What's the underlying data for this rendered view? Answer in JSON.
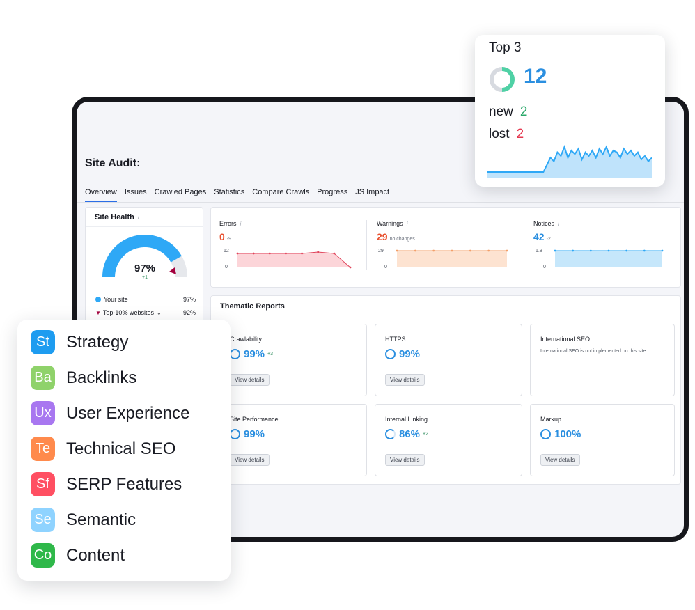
{
  "site_audit": {
    "title": "Site Audit:",
    "tabs": [
      "Overview",
      "Issues",
      "Crawled Pages",
      "Statistics",
      "Compare Crawls",
      "Progress",
      "JS Impact"
    ]
  },
  "site_health": {
    "title": "Site Health",
    "info": "i",
    "value": "97%",
    "delta": "+1",
    "gauge_fraction": 0.97,
    "legend": [
      {
        "label": "Your site",
        "value": "97%"
      },
      {
        "label": "Top-10% websites",
        "value": "92%"
      }
    ]
  },
  "summary": {
    "errors": {
      "label": "Errors",
      "info": "i",
      "value": "0",
      "delta": "-9",
      "color": "#e8502f",
      "ymax": "12",
      "ymin": "0",
      "values": [
        10,
        10,
        10,
        10,
        10,
        11,
        10,
        0
      ]
    },
    "warnings": {
      "label": "Warnings",
      "info": "i",
      "value": "29",
      "delta": "no changes",
      "color": "#e8502f",
      "ymax": "29",
      "ymin": "0",
      "values": [
        29,
        29,
        29,
        29,
        29,
        29,
        29
      ]
    },
    "notices": {
      "label": "Notices",
      "info": "i",
      "value": "42",
      "delta": "-2",
      "color": "#2b8fe0",
      "ymax": "1.8",
      "ymin": "0",
      "values": [
        1.8,
        1.8,
        1.8,
        1.8,
        1.8,
        1.8,
        1.8
      ]
    }
  },
  "thematic": {
    "title": "Thematic Reports",
    "view_label": "View details",
    "reports": [
      {
        "name": "Crawlability",
        "value": "99%",
        "delta": "+3"
      },
      {
        "name": "HTTPS",
        "value": "99%",
        "delta": ""
      },
      {
        "name": "International SEO",
        "note": "International SEO is not implemented on this site."
      },
      {
        "name": "Site Performance",
        "value": "99%",
        "delta": ""
      },
      {
        "name": "Internal Linking",
        "value": "86%",
        "delta": "+2"
      },
      {
        "name": "Markup",
        "value": "100%",
        "delta": ""
      }
    ]
  },
  "top3": {
    "title": "Top 3",
    "value": "12",
    "new_label": "new",
    "new_value": "2",
    "lost_label": "lost",
    "lost_value": "2",
    "trend": [
      0,
      0,
      0,
      0,
      0,
      0,
      0,
      0,
      0,
      0,
      0,
      0,
      0,
      0,
      0,
      0,
      0,
      4,
      8,
      6,
      11,
      9,
      14,
      8,
      12,
      10,
      13,
      7,
      11,
      9,
      12,
      8,
      13,
      10,
      14,
      9,
      12,
      11,
      8,
      13,
      10,
      12,
      9,
      11,
      7,
      9,
      6,
      8
    ]
  },
  "tools": [
    {
      "abbr": "St",
      "label": "Strategy",
      "color": "#1e9cf0"
    },
    {
      "abbr": "Ba",
      "label": "Backlinks",
      "color": "#8fd26a"
    },
    {
      "abbr": "Ux",
      "label": "User Experience",
      "color": "#a877f0"
    },
    {
      "abbr": "Te",
      "label": "Technical SEO",
      "color": "#ff8a4c"
    },
    {
      "abbr": "Sf",
      "label": "SERP Features",
      "color": "#ff4f62"
    },
    {
      "abbr": "Se",
      "label": "Semantic",
      "color": "#8fd3ff"
    },
    {
      "abbr": "Co",
      "label": "Content",
      "color": "#2fb84a"
    }
  ]
}
